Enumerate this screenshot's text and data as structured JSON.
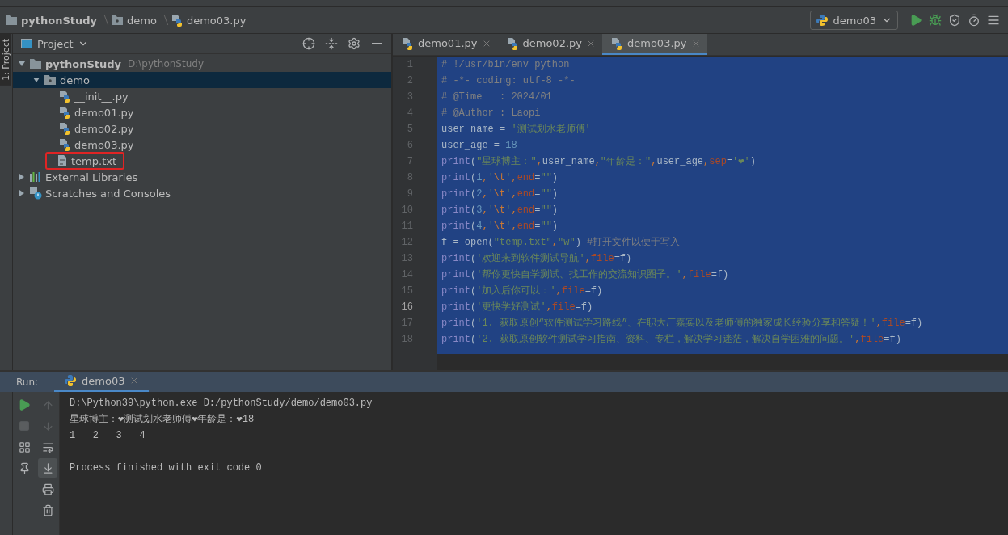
{
  "breadcrumbs": [
    {
      "kind": "project",
      "label": "pythonStudy"
    },
    {
      "kind": "package",
      "label": "demo"
    },
    {
      "kind": "python",
      "label": "demo03.py"
    }
  ],
  "run_config": {
    "label": "demo03"
  },
  "side_tab": {
    "label": "1: Project"
  },
  "project_panel": {
    "title": "Project",
    "tree": [
      {
        "kind": "folder",
        "label": "pythonStudy",
        "hint": "D:\\pythonStudy",
        "expanded": true,
        "selected": false,
        "marked": false,
        "children": [
          {
            "kind": "package",
            "label": "demo",
            "expanded": true,
            "selected": true,
            "marked": false,
            "children": [
              {
                "kind": "python",
                "label": "__init__.py",
                "selected": false,
                "marked": false
              },
              {
                "kind": "python",
                "label": "demo01.py",
                "selected": false,
                "marked": false
              },
              {
                "kind": "python",
                "label": "demo02.py",
                "selected": false,
                "marked": false
              },
              {
                "kind": "python",
                "label": "demo03.py",
                "selected": false,
                "marked": false
              },
              {
                "kind": "text",
                "label": "temp.txt",
                "selected": false,
                "marked": true
              }
            ]
          }
        ]
      },
      {
        "kind": "libraries",
        "label": "External Libraries",
        "expanded": false,
        "selected": false,
        "marked": false
      },
      {
        "kind": "scratches",
        "label": "Scratches and Consoles",
        "expanded": false,
        "selected": false,
        "marked": false
      }
    ]
  },
  "editor_tabs": [
    {
      "label": "demo01.py",
      "selected": false
    },
    {
      "label": "demo02.py",
      "selected": false
    },
    {
      "label": "demo03.py",
      "selected": true
    }
  ],
  "code_lines": [
    {
      "no": "1",
      "current": false,
      "tokens": [
        {
          "kind": "comment",
          "t": "# !/usr/bin/env python"
        }
      ]
    },
    {
      "no": "2",
      "current": false,
      "tokens": [
        {
          "kind": "comment",
          "t": "# -*- coding: utf-8 -*-"
        }
      ]
    },
    {
      "no": "3",
      "current": false,
      "tokens": [
        {
          "kind": "comment",
          "t": "# @Time   : 2024/01"
        }
      ]
    },
    {
      "no": "4",
      "current": false,
      "tokens": [
        {
          "kind": "comment",
          "t": "# @Author : Laopi"
        }
      ]
    },
    {
      "no": "5",
      "current": false,
      "tokens": [
        {
          "kind": "plain",
          "t": "user_name = "
        },
        {
          "kind": "string",
          "t": "'测试划水老师傅'"
        }
      ]
    },
    {
      "no": "6",
      "current": false,
      "tokens": [
        {
          "kind": "plain",
          "t": "user_age = "
        },
        {
          "kind": "number",
          "t": "18"
        }
      ]
    },
    {
      "no": "7",
      "current": false,
      "tokens": [
        {
          "kind": "builtin",
          "t": "print"
        },
        {
          "kind": "plain",
          "t": "("
        },
        {
          "kind": "string",
          "t": "\"星球博主：\""
        },
        {
          "kind": "operator",
          "t": ","
        },
        {
          "kind": "plain",
          "t": "user_name"
        },
        {
          "kind": "operator",
          "t": ","
        },
        {
          "kind": "string",
          "t": "\"年龄是：\""
        },
        {
          "kind": "operator",
          "t": ","
        },
        {
          "kind": "plain",
          "t": "user_age"
        },
        {
          "kind": "operator",
          "t": ","
        },
        {
          "kind": "keyword",
          "t": "sep"
        },
        {
          "kind": "plain",
          "t": "="
        },
        {
          "kind": "string",
          "t": "'❤'"
        },
        {
          "kind": "plain",
          "t": ")"
        }
      ]
    },
    {
      "no": "8",
      "current": false,
      "tokens": [
        {
          "kind": "builtin",
          "t": "print"
        },
        {
          "kind": "plain",
          "t": "("
        },
        {
          "kind": "number",
          "t": "1"
        },
        {
          "kind": "operator",
          "t": ","
        },
        {
          "kind": "string",
          "t": "'"
        },
        {
          "kind": "escape",
          "t": "\\t"
        },
        {
          "kind": "string",
          "t": "'"
        },
        {
          "kind": "operator",
          "t": ","
        },
        {
          "kind": "keyword",
          "t": "end"
        },
        {
          "kind": "plain",
          "t": "="
        },
        {
          "kind": "string",
          "t": "\"\""
        },
        {
          "kind": "plain",
          "t": ")"
        }
      ]
    },
    {
      "no": "9",
      "current": false,
      "tokens": [
        {
          "kind": "builtin",
          "t": "print"
        },
        {
          "kind": "plain",
          "t": "("
        },
        {
          "kind": "number",
          "t": "2"
        },
        {
          "kind": "operator",
          "t": ","
        },
        {
          "kind": "string",
          "t": "'"
        },
        {
          "kind": "escape",
          "t": "\\t"
        },
        {
          "kind": "string",
          "t": "'"
        },
        {
          "kind": "operator",
          "t": ","
        },
        {
          "kind": "keyword",
          "t": "end"
        },
        {
          "kind": "plain",
          "t": "="
        },
        {
          "kind": "string",
          "t": "\"\""
        },
        {
          "kind": "plain",
          "t": ")"
        }
      ]
    },
    {
      "no": "10",
      "current": false,
      "tokens": [
        {
          "kind": "builtin",
          "t": "print"
        },
        {
          "kind": "plain",
          "t": "("
        },
        {
          "kind": "number",
          "t": "3"
        },
        {
          "kind": "operator",
          "t": ","
        },
        {
          "kind": "string",
          "t": "'"
        },
        {
          "kind": "escape",
          "t": "\\t"
        },
        {
          "kind": "string",
          "t": "'"
        },
        {
          "kind": "operator",
          "t": ","
        },
        {
          "kind": "keyword",
          "t": "end"
        },
        {
          "kind": "plain",
          "t": "="
        },
        {
          "kind": "string",
          "t": "\"\""
        },
        {
          "kind": "plain",
          "t": ")"
        }
      ]
    },
    {
      "no": "11",
      "current": false,
      "tokens": [
        {
          "kind": "builtin",
          "t": "print"
        },
        {
          "kind": "plain",
          "t": "("
        },
        {
          "kind": "number",
          "t": "4"
        },
        {
          "kind": "operator",
          "t": ","
        },
        {
          "kind": "string",
          "t": "'"
        },
        {
          "kind": "escape",
          "t": "\\t"
        },
        {
          "kind": "string",
          "t": "'"
        },
        {
          "kind": "operator",
          "t": ","
        },
        {
          "kind": "keyword",
          "t": "end"
        },
        {
          "kind": "plain",
          "t": "="
        },
        {
          "kind": "string",
          "t": "\"\""
        },
        {
          "kind": "plain",
          "t": ")"
        }
      ]
    },
    {
      "no": "12",
      "current": false,
      "tokens": [
        {
          "kind": "plain",
          "t": "f = open("
        },
        {
          "kind": "string",
          "t": "\"temp.txt\""
        },
        {
          "kind": "operator",
          "t": ","
        },
        {
          "kind": "string",
          "t": "\"w\""
        },
        {
          "kind": "plain",
          "t": ") "
        },
        {
          "kind": "comment",
          "t": "#打开文件以便于写入"
        }
      ]
    },
    {
      "no": "13",
      "current": false,
      "tokens": [
        {
          "kind": "builtin",
          "t": "print"
        },
        {
          "kind": "plain",
          "t": "("
        },
        {
          "kind": "string",
          "t": "'欢迎来到软件测试导航'"
        },
        {
          "kind": "operator",
          "t": ","
        },
        {
          "kind": "keyword",
          "t": "file"
        },
        {
          "kind": "plain",
          "t": "=f)"
        }
      ]
    },
    {
      "no": "14",
      "current": false,
      "tokens": [
        {
          "kind": "builtin",
          "t": "print"
        },
        {
          "kind": "plain",
          "t": "("
        },
        {
          "kind": "string",
          "t": "'帮你更快自学测试、找工作的交流知识圈子。'"
        },
        {
          "kind": "operator",
          "t": ","
        },
        {
          "kind": "keyword",
          "t": "file"
        },
        {
          "kind": "plain",
          "t": "=f)"
        }
      ]
    },
    {
      "no": "15",
      "current": false,
      "tokens": [
        {
          "kind": "builtin",
          "t": "print"
        },
        {
          "kind": "plain",
          "t": "("
        },
        {
          "kind": "string",
          "t": "'加入后你可以：'"
        },
        {
          "kind": "operator",
          "t": ","
        },
        {
          "kind": "keyword",
          "t": "file"
        },
        {
          "kind": "plain",
          "t": "=f)"
        }
      ]
    },
    {
      "no": "16",
      "current": true,
      "tokens": [
        {
          "kind": "builtin",
          "t": "print"
        },
        {
          "kind": "plain",
          "t": "("
        },
        {
          "kind": "string",
          "t": "'更快学好测试'"
        },
        {
          "kind": "operator",
          "t": ","
        },
        {
          "kind": "keyword",
          "t": "file"
        },
        {
          "kind": "plain",
          "t": "=f)"
        }
      ]
    },
    {
      "no": "17",
      "current": false,
      "tokens": [
        {
          "kind": "builtin",
          "t": "print"
        },
        {
          "kind": "plain",
          "t": "("
        },
        {
          "kind": "string",
          "t": "'1. 获取原创“软件测试学习路线”、在职大厂嘉宾以及老师傅的独家成长经验分享和答疑！'"
        },
        {
          "kind": "operator",
          "t": ","
        },
        {
          "kind": "keyword",
          "t": "file"
        },
        {
          "kind": "plain",
          "t": "=f)"
        }
      ]
    },
    {
      "no": "18",
      "current": false,
      "tokens": [
        {
          "kind": "builtin",
          "t": "print"
        },
        {
          "kind": "plain",
          "t": "("
        },
        {
          "kind": "string",
          "t": "'2. 获取原创软件测试学习指南、资料、专栏，解决学习迷茫，解决自学困难的问题。'"
        },
        {
          "kind": "operator",
          "t": ","
        },
        {
          "kind": "keyword",
          "t": "file"
        },
        {
          "kind": "plain",
          "t": "=f)"
        }
      ]
    }
  ],
  "run_panel": {
    "title": "Run:",
    "tab": {
      "label": "demo03",
      "selected": true
    },
    "output": [
      "D:\\Python39\\python.exe D:/pythonStudy/demo/demo03.py",
      "星球博主：❤测试划水老师傅❤年龄是：❤18",
      "1\t2\t3\t4"
    ],
    "exit_message": "Process finished with exit code 0"
  }
}
